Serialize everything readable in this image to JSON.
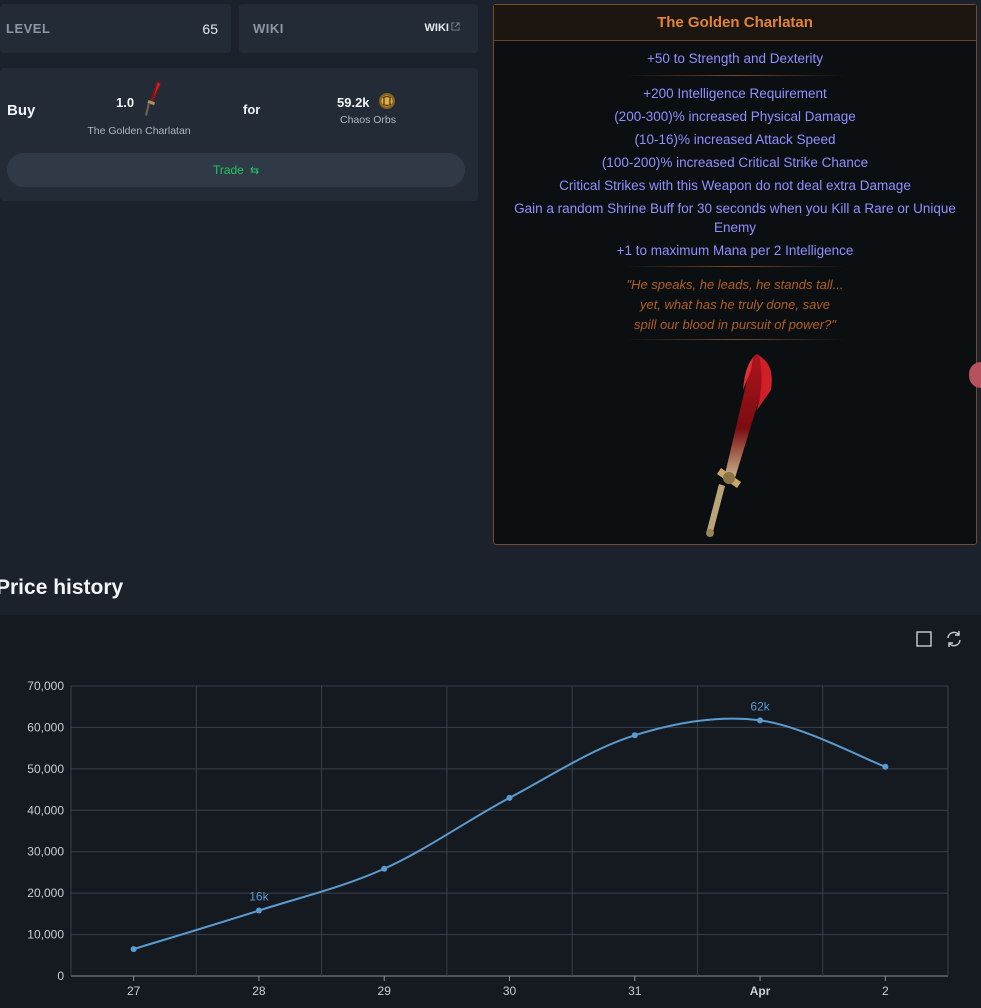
{
  "stats": {
    "level_label": "LEVEL",
    "level_value": "65",
    "wiki_label": "WIKI",
    "wiki_link": "WIKI"
  },
  "trade": {
    "buy_label": "Buy",
    "quantity": "1.0",
    "item_name": "The Golden Charlatan",
    "for_label": "for",
    "price": "59.2k",
    "currency": "Chaos Orbs",
    "trade_button": "Trade",
    "swap_icon": "⇆"
  },
  "item": {
    "name": "The Golden Charlatan",
    "implicit": "+50 to Strength and Dexterity",
    "mods": [
      "+200 Intelligence Requirement",
      "(200-300)% increased Physical Damage",
      "(10-16)% increased Attack Speed",
      "(100-200)% increased Critical Strike Chance",
      "Critical Strikes with this Weapon do not deal extra Damage",
      "Gain a random Shrine Buff for 30 seconds when you Kill a Rare or Unique Enemy",
      "+1 to maximum Mana per 2 Intelligence"
    ],
    "flavour": [
      "\"He speaks, he leads, he stands tall...",
      "yet, what has he truly done, save",
      "spill our blood in pursuit of power?\""
    ]
  },
  "price_history": {
    "title": "Price history",
    "toolbar_icons": [
      "square-icon",
      "refresh-icon"
    ]
  },
  "colors": {
    "line": "#5a9bd0",
    "unique_name": "#e0843c",
    "mod": "#8f8fff",
    "flavour": "#b25e24",
    "trade_green": "#22c55e"
  },
  "chart_data": {
    "type": "line",
    "categories": [
      "27",
      "28",
      "29",
      "30",
      "31",
      "Apr",
      "2"
    ],
    "series": [
      {
        "values": [
          6500,
          15800,
          25900,
          43000,
          58100,
          61700,
          50500
        ]
      }
    ],
    "data_labels": [
      {
        "index": 1,
        "text": "16k"
      },
      {
        "index": 5,
        "text": "62k"
      }
    ],
    "y_ticks": [
      "0",
      "10,000",
      "20,000",
      "30,000",
      "40,000",
      "50,000",
      "60,000",
      "70,000"
    ],
    "ylim": [
      0,
      70000
    ],
    "grid": true,
    "smooth": true
  }
}
